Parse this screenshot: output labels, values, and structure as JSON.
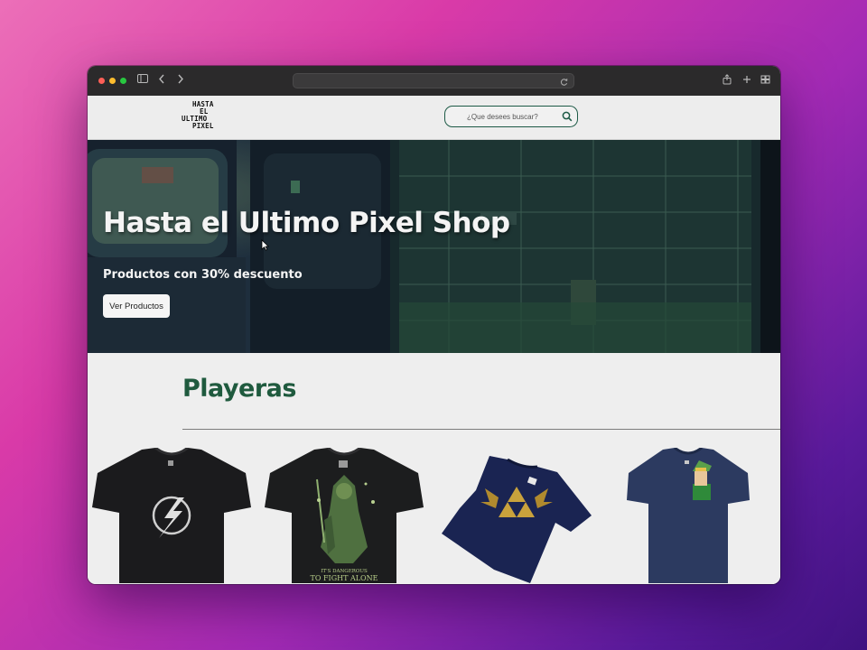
{
  "browser": {
    "url": ""
  },
  "site": {
    "logo_lines": [
      "HASTA",
      "EL",
      "ULTIMO",
      "PIXEL"
    ],
    "search_placeholder": "¿Que desees buscar?"
  },
  "hero": {
    "title": "Hasta el Ultimo Pixel Shop",
    "subtitle": "Productos con 30% descuento",
    "button_label": "Ver Productos"
  },
  "section": {
    "title": "Playeras",
    "products": [
      {
        "name": "flash-tshirt",
        "color": "#1b1b1d"
      },
      {
        "name": "zelda-link-tshirt",
        "color": "#1c1d1e",
        "print_lines": [
          "IT'S DANGEROUS",
          "TO FIGHT ALONE"
        ]
      },
      {
        "name": "triforce-tshirt",
        "color": "#1a2452"
      },
      {
        "name": "pocket-link-tshirt",
        "color": "#2c3a60"
      }
    ]
  },
  "colors": {
    "accent_green": "#1f5a3e",
    "page_bg": "#eeeeee",
    "titlebar": "#2b2a2b"
  }
}
